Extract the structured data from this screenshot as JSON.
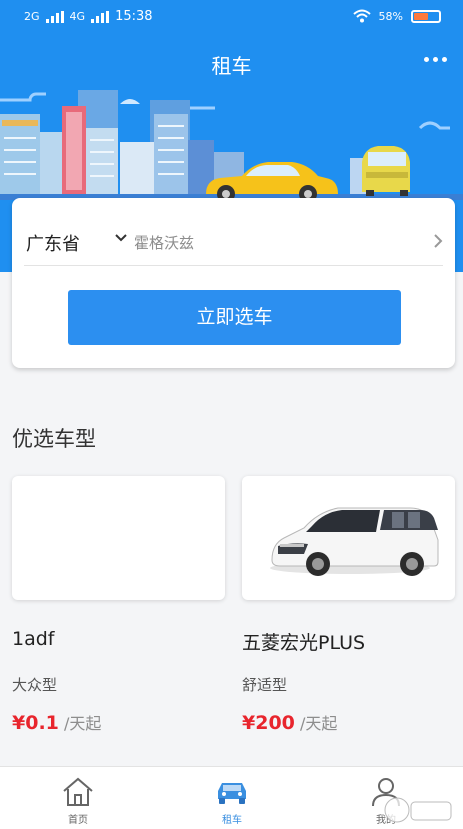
{
  "status_bar": {
    "network_left": "2G",
    "network_right": "4G",
    "time": "15:38",
    "battery": "58%"
  },
  "header": {
    "title": "租车",
    "more_icon": "more-dots-icon"
  },
  "search": {
    "province": "广东省",
    "city": "霍格沃兹",
    "button": "立即选车"
  },
  "section": {
    "title": "优选车型"
  },
  "cars": [
    {
      "name": "1adf",
      "type": "大众型",
      "price": "¥0.1",
      "unit": "/天起",
      "has_image": false
    },
    {
      "name": "五菱宏光PLUS",
      "type": "舒适型",
      "price": "¥200",
      "unit": "/天起",
      "has_image": true
    }
  ],
  "tabs": [
    {
      "label": "首页",
      "icon": "home-icon",
      "active": false
    },
    {
      "label": "租车",
      "icon": "car-icon",
      "active": true
    },
    {
      "label": "我的",
      "icon": "user-icon",
      "active": false
    }
  ],
  "colors": {
    "primary": "#1f8ff0",
    "button": "#2c8ff0",
    "price": "#e8252d",
    "tab_active": "#3a8fe0",
    "tab_inactive": "#666666"
  }
}
